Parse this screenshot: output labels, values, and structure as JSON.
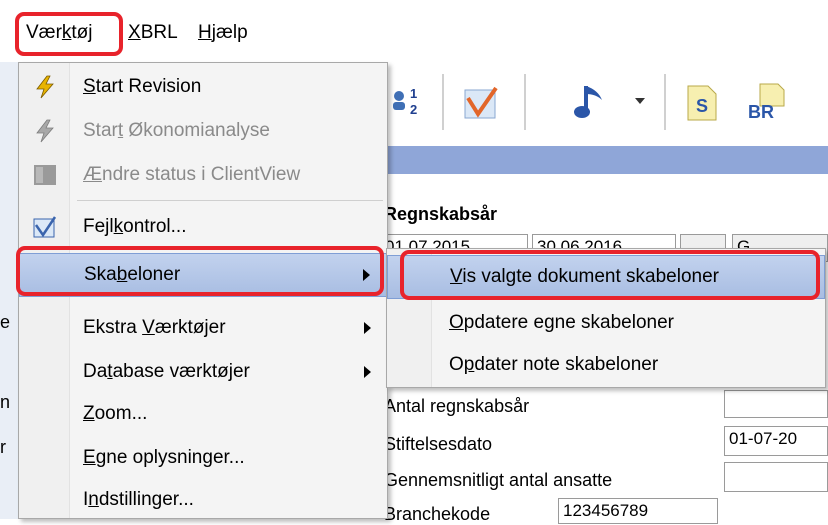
{
  "menubar": {
    "vaerktoj": {
      "pre": "Vær",
      "key": "k",
      "post": "tøj"
    },
    "xbrl": {
      "pre": "",
      "key": "X",
      "post": "BRL"
    },
    "hjaelp": {
      "pre": "",
      "key": "H",
      "post": "jælp"
    }
  },
  "menu": {
    "items": [
      {
        "pre": "",
        "key": "S",
        "post": "tart Revision",
        "icon": "lightning-icon"
      },
      {
        "pre": "Star",
        "key": "t",
        "post": " Økonomianalyse",
        "icon": "lightning-disabled-icon"
      },
      {
        "pre": "",
        "key": "Æ",
        "post": "ndre status i ClientView",
        "icon": "status-disabled-icon"
      },
      {
        "pre": "Fejl",
        "key": "k",
        "post": "ontrol...",
        "icon": "checkmark-chart-icon"
      },
      {
        "pre": "Ska",
        "key": "b",
        "post": "eloner"
      },
      {
        "pre": "Ekstra ",
        "key": "V",
        "post": "ærktøjer"
      },
      {
        "pre": "Da",
        "key": "t",
        "post": "abase værktøjer"
      },
      {
        "pre": "",
        "key": "Z",
        "post": "oom..."
      },
      {
        "pre": "",
        "key": "E",
        "post": "gne oplysninger..."
      },
      {
        "pre": "I",
        "key": "n",
        "post": "dstillinger..."
      }
    ]
  },
  "submenu": {
    "items": [
      {
        "pre": "",
        "key": "V",
        "post": "is valgte dokument skabeloner"
      },
      {
        "pre": "",
        "key": "O",
        "post": "pdatere egne skabeloner"
      },
      {
        "pre": "O",
        "key": "p",
        "post": "dater note skabeloner"
      }
    ]
  },
  "form": {
    "regnskabsaar_label": "Regnskabsår",
    "start_date": "01.07.2015",
    "end_date": "30.06.2016",
    "antal_label": "Antal regnskabsår",
    "stiftelses_label": "Stiftelsesdato",
    "stiftelses_value": "01-07-20",
    "ansatte_label": "Gennemsnitligt antal ansatte",
    "branche_label": "Branchekode",
    "branche_value": "123456789",
    "cut_button": "G"
  },
  "toolbar": {
    "icons": [
      "sort-icon",
      "checkmark-chart-icon",
      "music-note-icon",
      "dropdown-arrow-icon",
      "s-document-icon",
      "br-document-icon"
    ],
    "br_text": "BR",
    "s_text": "S"
  },
  "left_cut": [
    "e",
    "n",
    "r"
  ],
  "colors": {
    "highlight": "#e8232b",
    "menu_bg": "#f4f4f4",
    "selection": "#b4c6e7",
    "band": "#8fa6d8"
  }
}
